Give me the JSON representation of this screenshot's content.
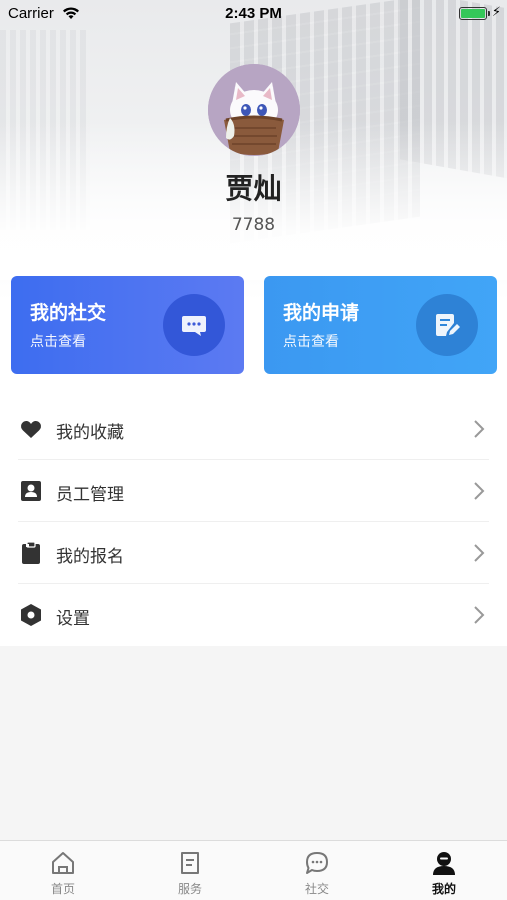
{
  "status_bar": {
    "carrier": "Carrier",
    "time": "2:43 PM",
    "battery_level": 1.0
  },
  "profile": {
    "name": "贾灿",
    "id": "7788"
  },
  "cards": [
    {
      "title": "我的社交",
      "subtitle": "点击查看",
      "icon": "chat-bubble-icon",
      "color": "#4a6ff0"
    },
    {
      "title": "我的申请",
      "subtitle": "点击查看",
      "icon": "document-edit-icon",
      "color": "#3d9ef4"
    }
  ],
  "menu": {
    "items": [
      {
        "label": "我的收藏",
        "icon": "heart-icon"
      },
      {
        "label": "员工管理",
        "icon": "id-card-icon"
      },
      {
        "label": "我的报名",
        "icon": "clipboard-icon"
      },
      {
        "label": "设置",
        "icon": "hexagon-gear-icon"
      }
    ]
  },
  "tabbar": {
    "tabs": [
      {
        "label": "首页",
        "icon": "home-icon",
        "active": false
      },
      {
        "label": "服务",
        "icon": "document-icon",
        "active": false
      },
      {
        "label": "社交",
        "icon": "chat-icon",
        "active": false
      },
      {
        "label": "我的",
        "icon": "user-icon",
        "active": true
      }
    ]
  }
}
